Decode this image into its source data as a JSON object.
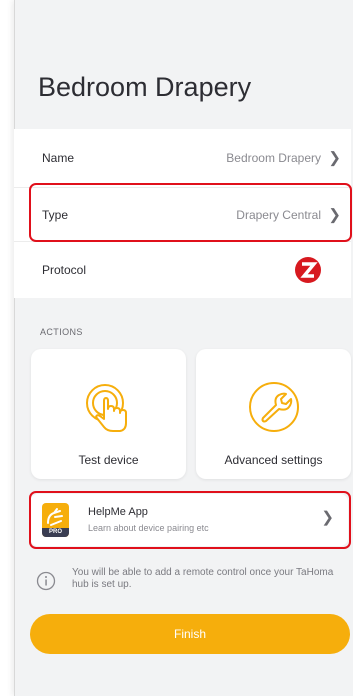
{
  "page": {
    "title": "Bedroom Drapery"
  },
  "settings": {
    "rows": [
      {
        "label": "Name",
        "value": "Bedroom Drapery",
        "chevron": "chevron-right-icon"
      },
      {
        "label": "Type",
        "value": "Drapery Central",
        "chevron": "chevron-right-icon"
      },
      {
        "label": "Protocol",
        "value": "",
        "icon": "zwave-protocol-icon"
      }
    ]
  },
  "actions": {
    "section_label": "ACTIONS",
    "tiles": [
      {
        "label": "Test device",
        "icon": "tap-hand-icon"
      },
      {
        "label": "Advanced settings",
        "icon": "wrench-icon"
      }
    ]
  },
  "helpme": {
    "name": "HelpMe App",
    "subtitle": "Learn about device pairing etc",
    "badge": "PRO",
    "icon": "helpme-app-icon"
  },
  "info": {
    "text": "You will be able to add a remote control once your TaHoma hub is set up.",
    "icon": "info-circle-icon"
  },
  "footer": {
    "finish_label": "Finish"
  },
  "colors": {
    "accent": "#f6ae0c",
    "highlight": "#e0101b",
    "protocol_red": "#d7191f"
  }
}
